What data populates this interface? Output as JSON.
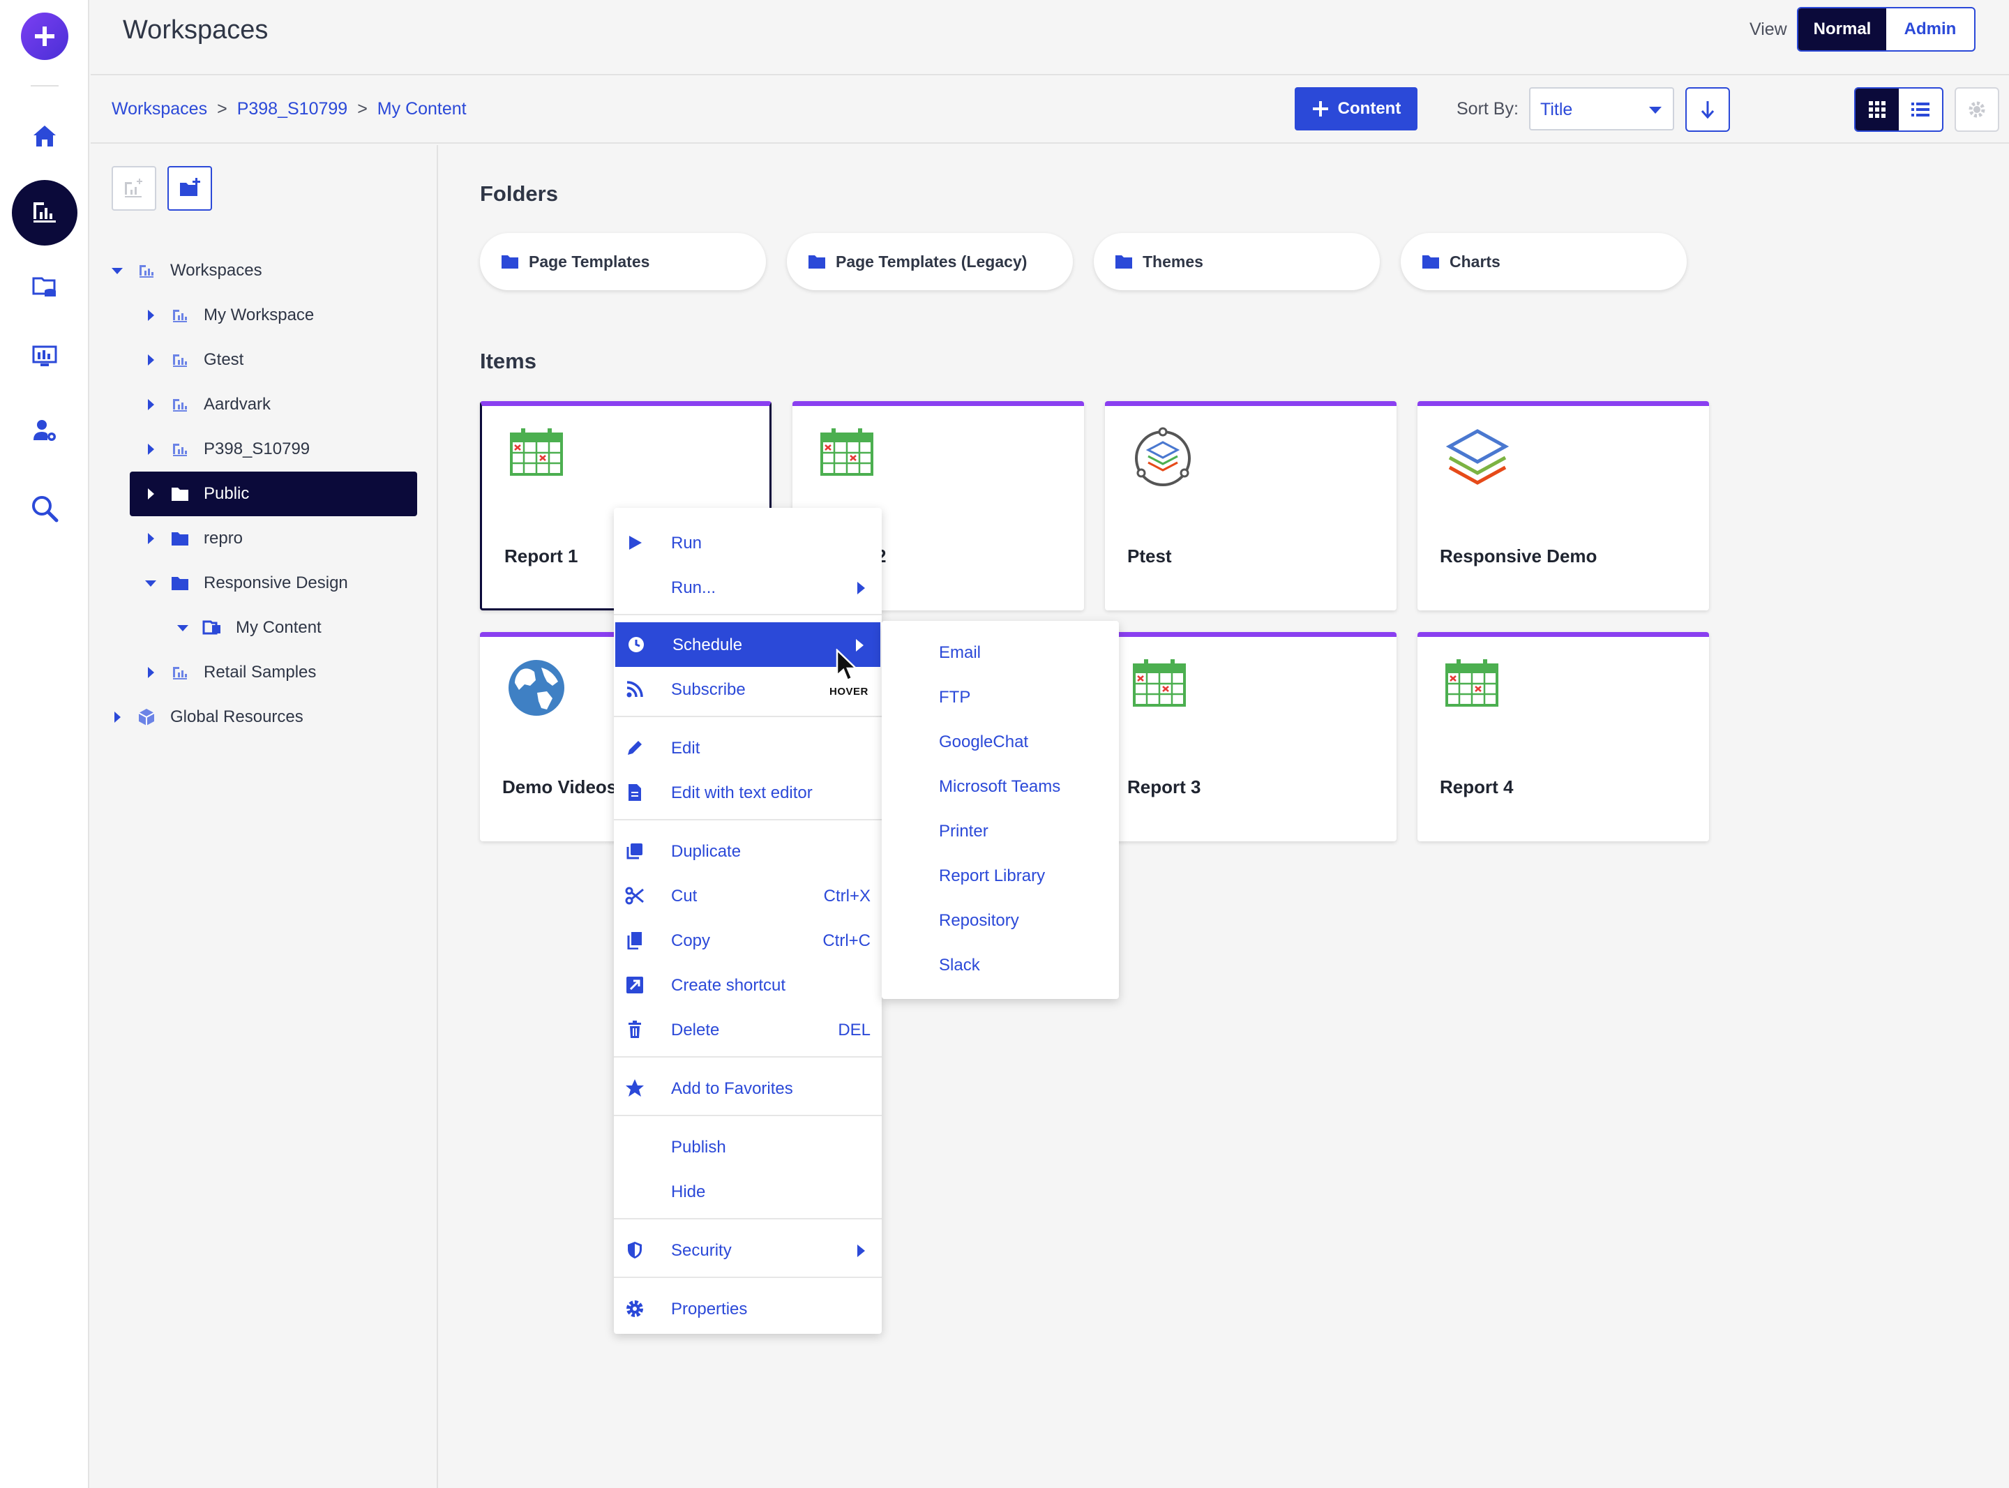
{
  "header": {
    "title": "Workspaces",
    "view_label": "View",
    "view_normal": "Normal",
    "view_admin": "Admin"
  },
  "breadcrumb": {
    "items": [
      "Workspaces",
      "P398_S10799",
      "My Content"
    ],
    "separator": ">"
  },
  "toolbar": {
    "content_button": "Content",
    "sort_label": "Sort By:",
    "sort_value": "Title"
  },
  "tree": {
    "items": [
      {
        "label": "Workspaces",
        "icon": "workspace-icon",
        "expanded": true
      },
      {
        "label": "My Workspace",
        "icon": "workspace-icon"
      },
      {
        "label": "Gtest",
        "icon": "workspace-icon"
      },
      {
        "label": "Aardvark",
        "icon": "workspace-icon"
      },
      {
        "label": "P398_S10799",
        "icon": "workspace-icon"
      },
      {
        "label": "Public",
        "icon": "folder-icon",
        "selected": true
      },
      {
        "label": "repro",
        "icon": "folder-icon"
      },
      {
        "label": "Responsive Design",
        "icon": "folder-icon",
        "expanded": true
      },
      {
        "label": "My Content",
        "icon": "my-content-icon",
        "expanded": true
      },
      {
        "label": "Retail Samples",
        "icon": "workspace-icon"
      },
      {
        "label": "Global Resources",
        "icon": "cube-icon"
      }
    ]
  },
  "main": {
    "folders_title": "Folders",
    "items_title": "Items",
    "folders": [
      "Page Templates",
      "Page Templates (Legacy)",
      "Themes",
      "Charts"
    ],
    "items": [
      {
        "label": "Report 1",
        "icon": "calendar-report-icon"
      },
      {
        "label": "2",
        "icon": "calendar-report-icon"
      },
      {
        "label": "Ptest",
        "icon": "portal-icon"
      },
      {
        "label": "Responsive Demo",
        "icon": "layers-icon"
      },
      {
        "label": "Demo Videos",
        "icon": "globe-icon"
      },
      {
        "label": "Report 3",
        "icon": "calendar-report-icon"
      },
      {
        "label": "Report 4",
        "icon": "calendar-report-icon"
      }
    ]
  },
  "context_menu": {
    "run": "Run",
    "run_dots": "Run...",
    "schedule": "Schedule",
    "subscribe": "Subscribe",
    "edit": "Edit",
    "edit_text": "Edit with text editor",
    "duplicate": "Duplicate",
    "cut": "Cut",
    "cut_shortcut": "Ctrl+X",
    "copy": "Copy",
    "copy_shortcut": "Ctrl+C",
    "create_shortcut": "Create shortcut",
    "delete": "Delete",
    "delete_shortcut": "DEL",
    "favorites": "Add to Favorites",
    "publish": "Publish",
    "hide": "Hide",
    "security": "Security",
    "properties": "Properties"
  },
  "schedule_submenu": [
    "Email",
    "FTP",
    "GoogleChat",
    "Microsoft Teams",
    "Printer",
    "Report Library",
    "Repository",
    "Slack"
  ],
  "hover_tag": "HOVER",
  "colors": {
    "accent": "#2b49d8",
    "dark": "#0b0a3a",
    "card_top": "#8a3ff0",
    "calendar_green": "#4caf50"
  }
}
